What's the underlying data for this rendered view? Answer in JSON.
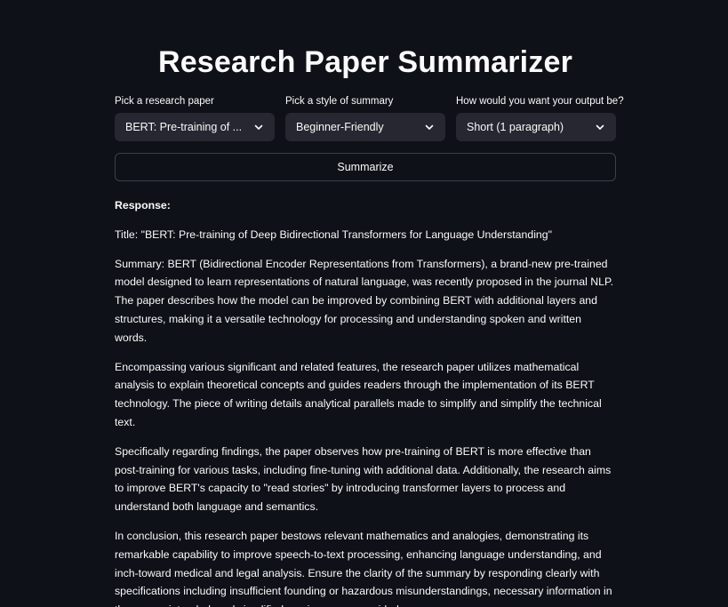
{
  "page": {
    "title": "Research Paper Summarizer"
  },
  "controls": {
    "paper": {
      "label": "Pick a research paper",
      "value": "BERT: Pre-training of ..."
    },
    "style": {
      "label": "Pick a style of summary",
      "value": "Beginner-Friendly"
    },
    "length": {
      "label": "How would you want your output be?",
      "value": "Short (1 paragraph)"
    },
    "icons": {
      "dropdown": "chevron-down-icon"
    }
  },
  "summarize_button": {
    "label": "Summarize"
  },
  "response": {
    "label": "Response:",
    "paragraphs": [
      "Title: \"BERT: Pre-training of Deep Bidirectional Transformers for Language Understanding\"",
      "Summary: BERT (Bidirectional Encoder Representations from Transformers), a brand-new pre-trained model designed to learn representations of natural language, was recently proposed in the journal NLP. The paper describes how the model can be improved by combining BERT with additional layers and structures, making it a versatile technology for processing and understanding spoken and written words.",
      "Encompassing various significant and related features, the research paper utilizes mathematical analysis to explain theoretical concepts and guides readers through the implementation of its BERT technology. The piece of writing details analytical parallels made to simplify and simplify the technical text.",
      "Specifically regarding findings, the paper observes how pre-training of BERT is more effective than post-training for various tasks, including fine-tuning with additional data. Additionally, the research aims to improve BERT's capacity to \"read stories\" by introducing transformer layers to process and understand both language and semantics.",
      "In conclusion, this research paper bestows relevant mathematics and analogies, demonstrating its remarkable capability to improve speech-to-text processing, enhancing language understanding, and inch-toward medical and legal analysis. Ensure the clarity of the summary by responding clearly with specifications including insufficient founding or hazardous misunderstandings, necessary information in the source intended, and simplified versions were provided."
    ]
  },
  "colors": {
    "background": "#0e1117",
    "text": "#fafafa",
    "select_background": "#262730",
    "button_border": "#3d404a"
  }
}
